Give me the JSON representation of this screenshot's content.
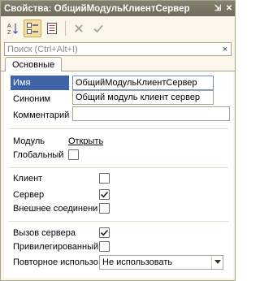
{
  "window": {
    "title": "Свойства: ОбщийМодульКлиентСервер",
    "pin_glyph": "⇲",
    "close_glyph": "✕"
  },
  "toolbar": {
    "icons": [
      "sort-alphabetical-icon",
      "categorized-icon",
      "property-list-icon",
      "close-icon",
      "check-icon"
    ]
  },
  "search": {
    "placeholder": "Поиск (Ctrl+Alt+I)",
    "clear_glyph": "×"
  },
  "tabs": [
    {
      "label": "Основные"
    }
  ],
  "main": {
    "name": {
      "label": "Имя",
      "value": "ОбщийМодульКлиентСервер"
    },
    "synonym": {
      "label": "Синоним",
      "value": "Общий модуль клиент сервер"
    },
    "comment": {
      "label": "Комментарий",
      "value": ""
    },
    "module": {
      "label": "Модуль",
      "link": "Открыть"
    },
    "global": {
      "label": "Глобальный",
      "checked": false
    },
    "client": {
      "label": "Клиент",
      "checked": false
    },
    "server": {
      "label": "Сервер",
      "checked": true
    },
    "external": {
      "label": "Внешнее соединени",
      "checked": false
    },
    "server_call": {
      "label": "Вызов сервера",
      "checked": true
    },
    "privileged": {
      "label": "Привилегированный",
      "checked": false
    },
    "reuse": {
      "label": "Повторное использо",
      "value": "Не использовать"
    }
  },
  "colors": {
    "title_bar": "#7a7564",
    "selection": "#3e63a6",
    "panel_bg": "#fbf6e9"
  }
}
